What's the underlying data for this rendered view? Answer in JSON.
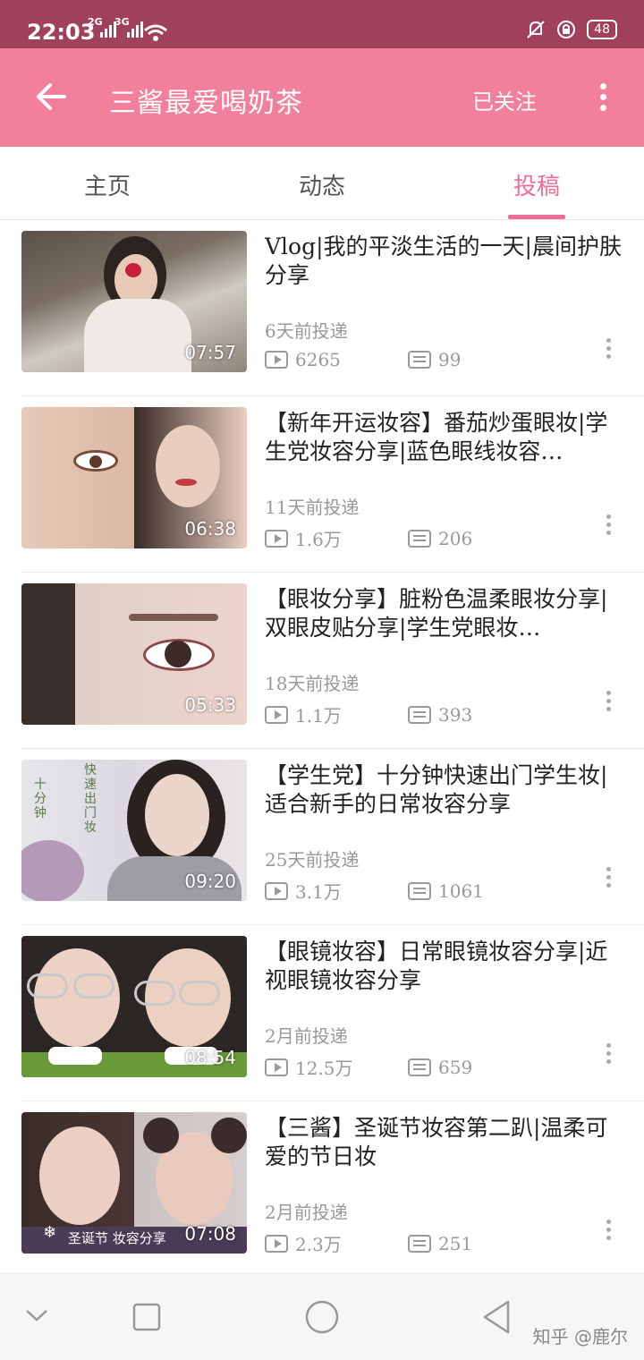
{
  "status_bar": {
    "time": "22:03",
    "net1": "2G",
    "net2": "3G",
    "battery": "48"
  },
  "app_bar": {
    "title": "三酱最爱喝奶茶",
    "follow_label": "已关注"
  },
  "tabs": [
    {
      "label": "主页",
      "active": false
    },
    {
      "label": "动态",
      "active": false
    },
    {
      "label": "投稿",
      "active": true
    }
  ],
  "videos": [
    {
      "title": "Vlog|我的平淡生活的一天|晨间护肤分享",
      "duration": "07:57",
      "date": "6天前投递",
      "views": "6265",
      "comments": "99"
    },
    {
      "title": "【新年开运妆容】番茄炒蛋眼妆|学生党妆容分享|蓝色眼线妆容…",
      "duration": "06:38",
      "date": "11天前投递",
      "views": "1.6万",
      "comments": "206"
    },
    {
      "title": "【眼妆分享】脏粉色温柔眼妆分享|双眼皮贴分享|学生党眼妆…",
      "duration": "05:33",
      "date": "18天前投递",
      "views": "1.1万",
      "comments": "393"
    },
    {
      "title": "【学生党】十分钟快速出门学生妆|适合新手的日常妆容分享",
      "duration": "09:20",
      "date": "25天前投递",
      "views": "3.1万",
      "comments": "1061"
    },
    {
      "title": "【眼镜妆容】日常眼镜妆容分享|近视眼镜妆容分享",
      "duration": "08:54",
      "date": "2月前投递",
      "views": "12.5万",
      "comments": "659"
    },
    {
      "title": "【三酱】圣诞节妆容第二趴|温柔可爱的节日妆",
      "duration": "07:08",
      "date": "2月前投递",
      "views": "2.3万",
      "comments": "251"
    }
  ],
  "thumbnail_text": {
    "v4_left": "十分钟",
    "v4_right": "快速出门妆",
    "v6_caption": "圣诞节 妆容分享"
  },
  "watermark": "知乎 @鹿尔",
  "colors": {
    "status_bar": "#a0405a",
    "app_bar": "#f27f9c",
    "accent": "#ef6f94"
  }
}
